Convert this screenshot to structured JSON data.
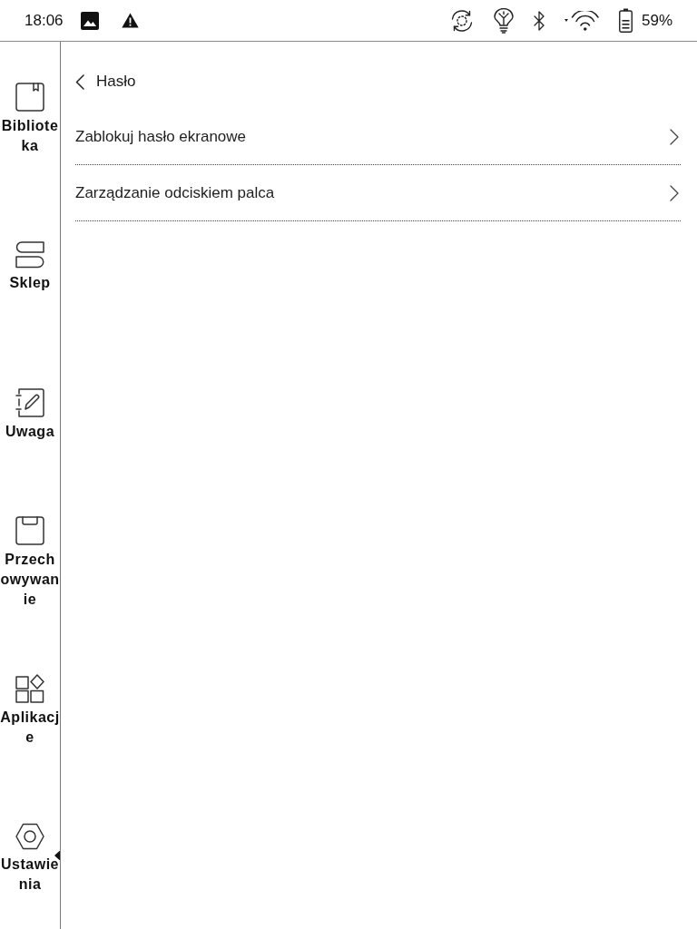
{
  "status_bar": {
    "time": "18:06",
    "battery": "59%"
  },
  "sidebar": {
    "items": [
      {
        "kind": "library",
        "label": "Biblioteka",
        "selected": false
      },
      {
        "kind": "store",
        "label": "Sklep",
        "selected": false
      },
      {
        "kind": "notes",
        "label": "Uwaga",
        "selected": false
      },
      {
        "kind": "storage",
        "label": "Przechowywanie",
        "selected": false
      },
      {
        "kind": "apps",
        "label": "Aplikacje",
        "selected": false
      },
      {
        "kind": "settings",
        "label": "Ustawienia",
        "selected": true
      }
    ]
  },
  "header": {
    "title": "Hasło"
  },
  "settings_rows": [
    {
      "label": "Zablokuj hasło ekranowe"
    },
    {
      "label": "Zarządzanie odciskiem palca"
    }
  ]
}
